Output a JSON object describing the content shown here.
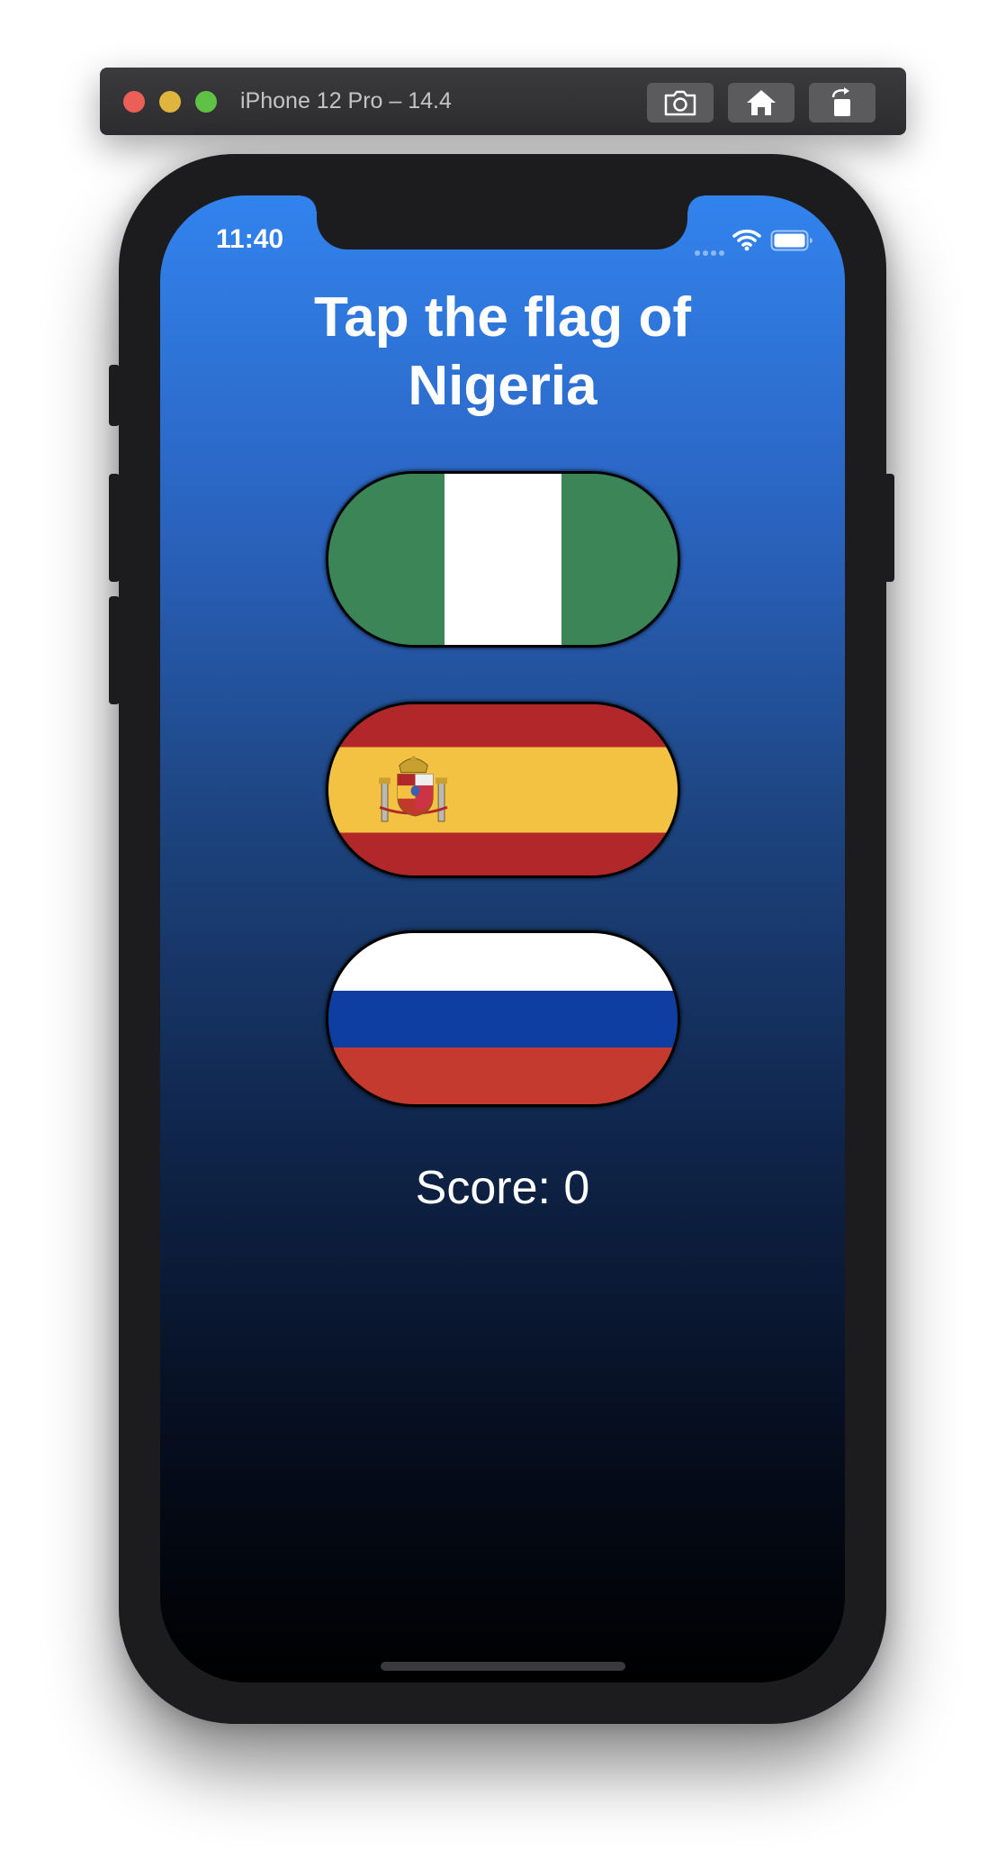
{
  "window": {
    "title": "iPhone 12 Pro – 14.4",
    "toolbar_buttons": [
      {
        "name": "screenshot",
        "icon": "camera-icon"
      },
      {
        "name": "home",
        "icon": "home-icon"
      },
      {
        "name": "rotate",
        "icon": "rotate-icon"
      }
    ]
  },
  "status_bar": {
    "time": "11:40",
    "icons": [
      "wifi-icon",
      "battery-icon"
    ]
  },
  "game": {
    "prompt_line1": "Tap the flag of",
    "prompt_line2": "Nigeria",
    "flags": [
      {
        "country": "Nigeria",
        "colors": [
          "#3b8556",
          "#ffffff",
          "#3b8556"
        ],
        "orientation": "vertical"
      },
      {
        "country": "Spain",
        "colors": [
          "#b2282a",
          "#f4c243",
          "#b2282a"
        ],
        "orientation": "horizontal"
      },
      {
        "country": "Russia",
        "colors": [
          "#ffffff",
          "#0f3ea3",
          "#c43a2e"
        ],
        "orientation": "horizontal"
      }
    ],
    "score_text": "Score: 0"
  },
  "colors": {
    "background_top": "#3283ee",
    "background_bottom": "#000000",
    "text": "#ffffff"
  }
}
